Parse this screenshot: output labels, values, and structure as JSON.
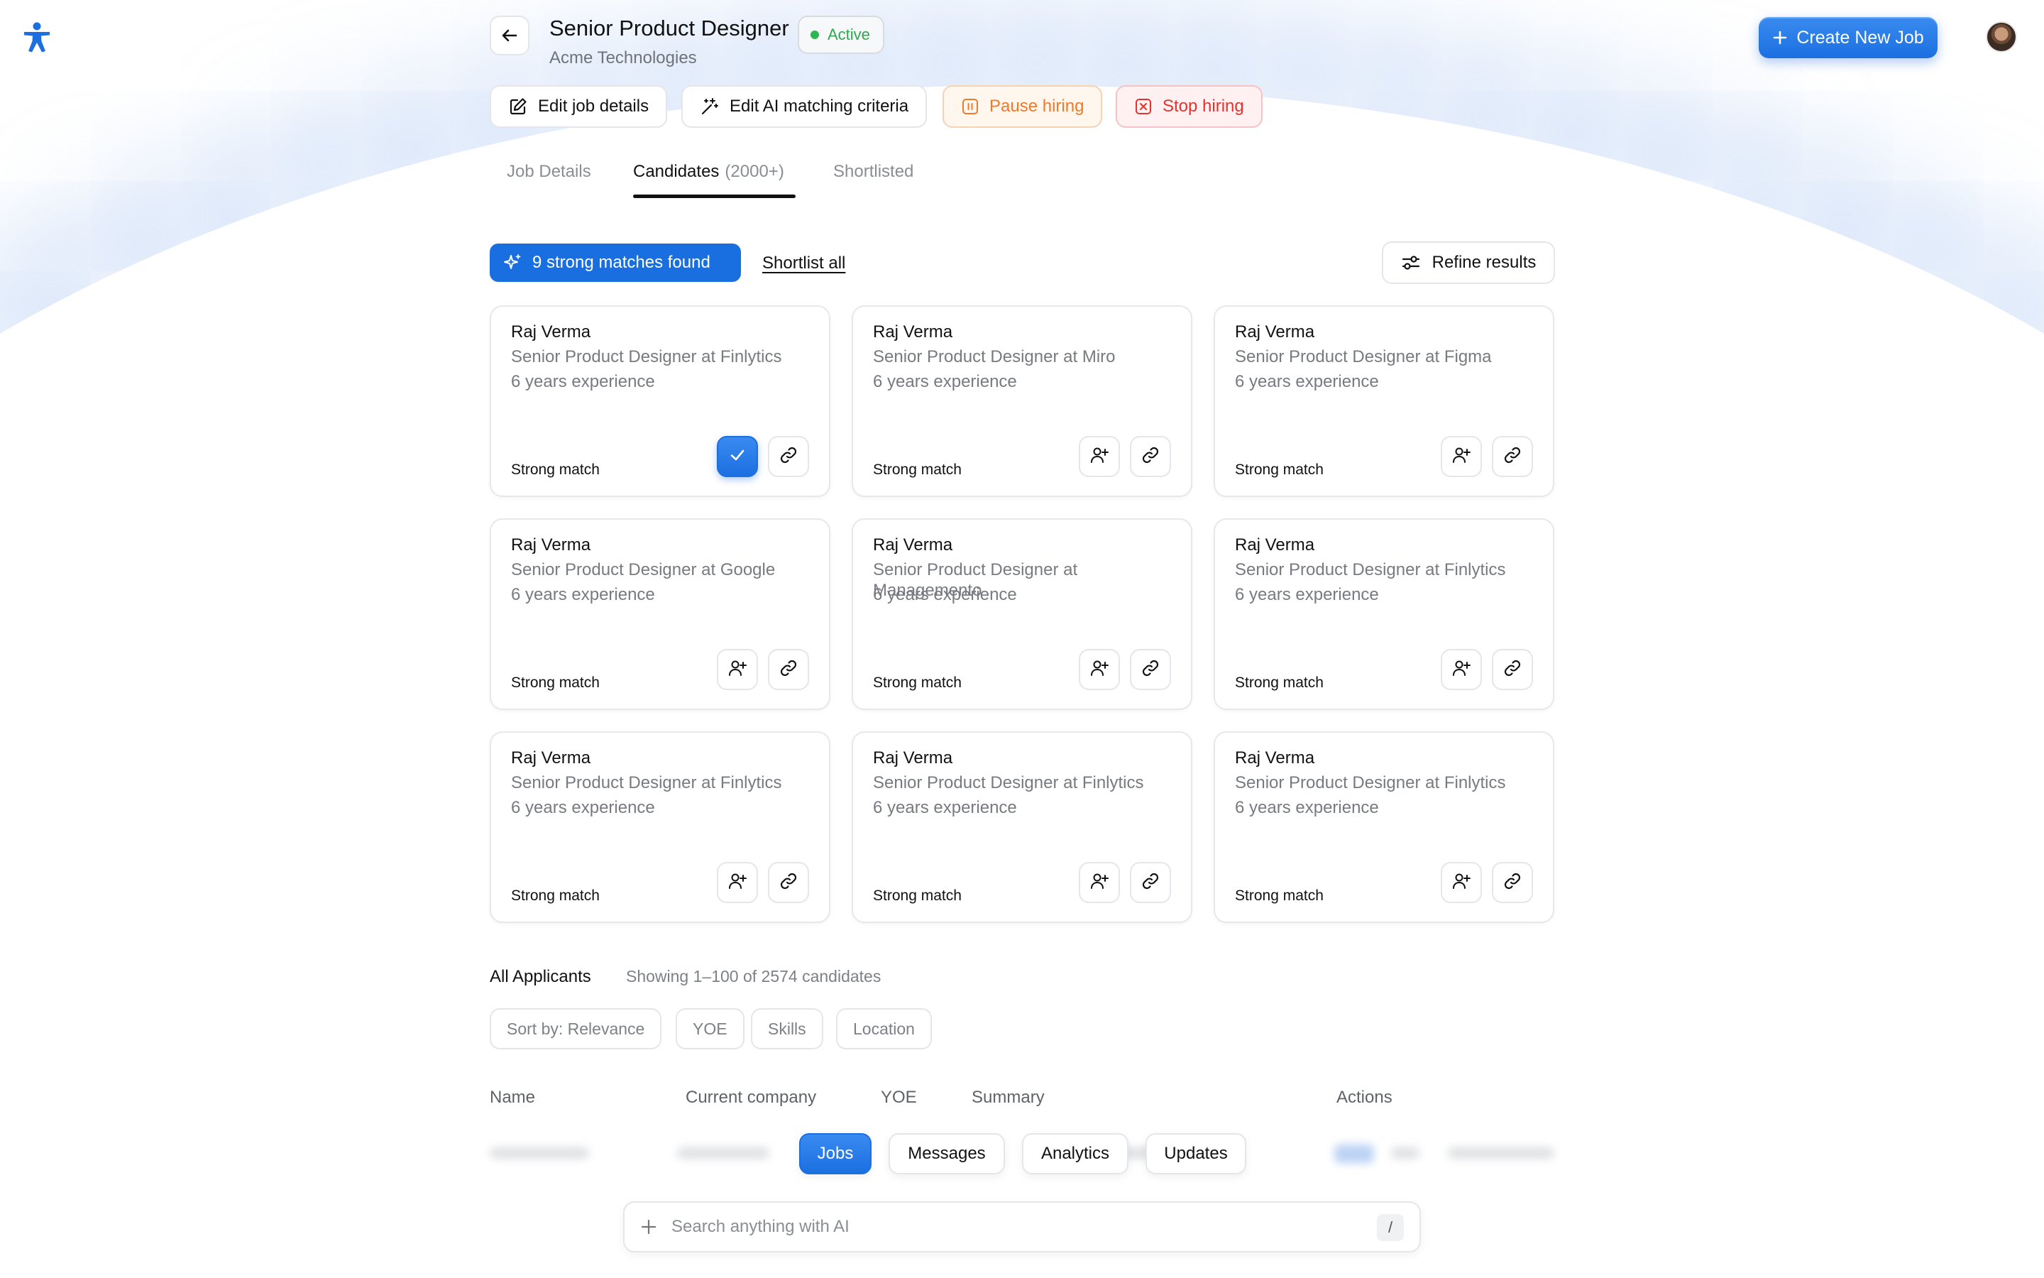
{
  "header": {
    "job_title": "Senior Product Designer",
    "company": "Acme Technologies",
    "status": "Active",
    "create_button": "Create New Job"
  },
  "actions": {
    "edit_job": "Edit job details",
    "edit_ai": "Edit AI matching criteria",
    "pause": "Pause hiring",
    "stop": "Stop hiring"
  },
  "tabs": {
    "job_details": "Job Details",
    "candidates": "Candidates",
    "candidates_count": "(2000+)",
    "shortlisted": "Shortlisted"
  },
  "matches": {
    "pill": "9 strong matches found",
    "shortlist_all": "Shortlist all",
    "refine": "Refine results"
  },
  "cards": [
    {
      "name": "Raj Verma",
      "role": "Senior Product Designer at Finlytics",
      "experience": "6 years experience",
      "match": "Strong match",
      "shortlisted": true
    },
    {
      "name": "Raj Verma",
      "role": "Senior Product Designer at Miro",
      "experience": "6 years experience",
      "match": "Strong match",
      "shortlisted": false
    },
    {
      "name": "Raj Verma",
      "role": "Senior Product Designer at Figma",
      "experience": "6 years experience",
      "match": "Strong match",
      "shortlisted": false
    },
    {
      "name": "Raj Verma",
      "role": "Senior Product Designer at Google",
      "experience": "6 years experience",
      "match": "Strong match",
      "shortlisted": false
    },
    {
      "name": "Raj Verma",
      "role": "Senior Product Designer at Managemento",
      "experience": "6 years experience",
      "match": "Strong match",
      "shortlisted": false
    },
    {
      "name": "Raj Verma",
      "role": "Senior Product Designer at Finlytics",
      "experience": "6 years experience",
      "match": "Strong match",
      "shortlisted": false
    },
    {
      "name": "Raj Verma",
      "role": "Senior Product Designer at Finlytics",
      "experience": "6 years experience",
      "match": "Strong match",
      "shortlisted": false
    },
    {
      "name": "Raj Verma",
      "role": "Senior Product Designer at Finlytics",
      "experience": "6 years experience",
      "match": "Strong match",
      "shortlisted": false
    },
    {
      "name": "Raj Verma",
      "role": "Senior Product Designer at Finlytics",
      "experience": "6 years experience",
      "match": "Strong match",
      "shortlisted": false
    }
  ],
  "applicants": {
    "title": "All Applicants",
    "subtitle": "Showing 1–100 of 2574 candidates",
    "filters": [
      "Sort by: Relevance",
      "YOE",
      "Skills",
      "Location"
    ],
    "columns": [
      "Name",
      "Current company",
      "YOE",
      "Summary",
      "Actions"
    ]
  },
  "bottom_nav": {
    "items": [
      "Jobs",
      "Messages",
      "Analytics",
      "Updates"
    ],
    "active": "Jobs"
  },
  "search": {
    "placeholder": "Search anything with AI",
    "shortcut": "/"
  },
  "colors": {
    "accent": "#1b6fe0",
    "active_status": "#2fb552",
    "pause": "#f07a2a",
    "stop": "#e2332f"
  }
}
